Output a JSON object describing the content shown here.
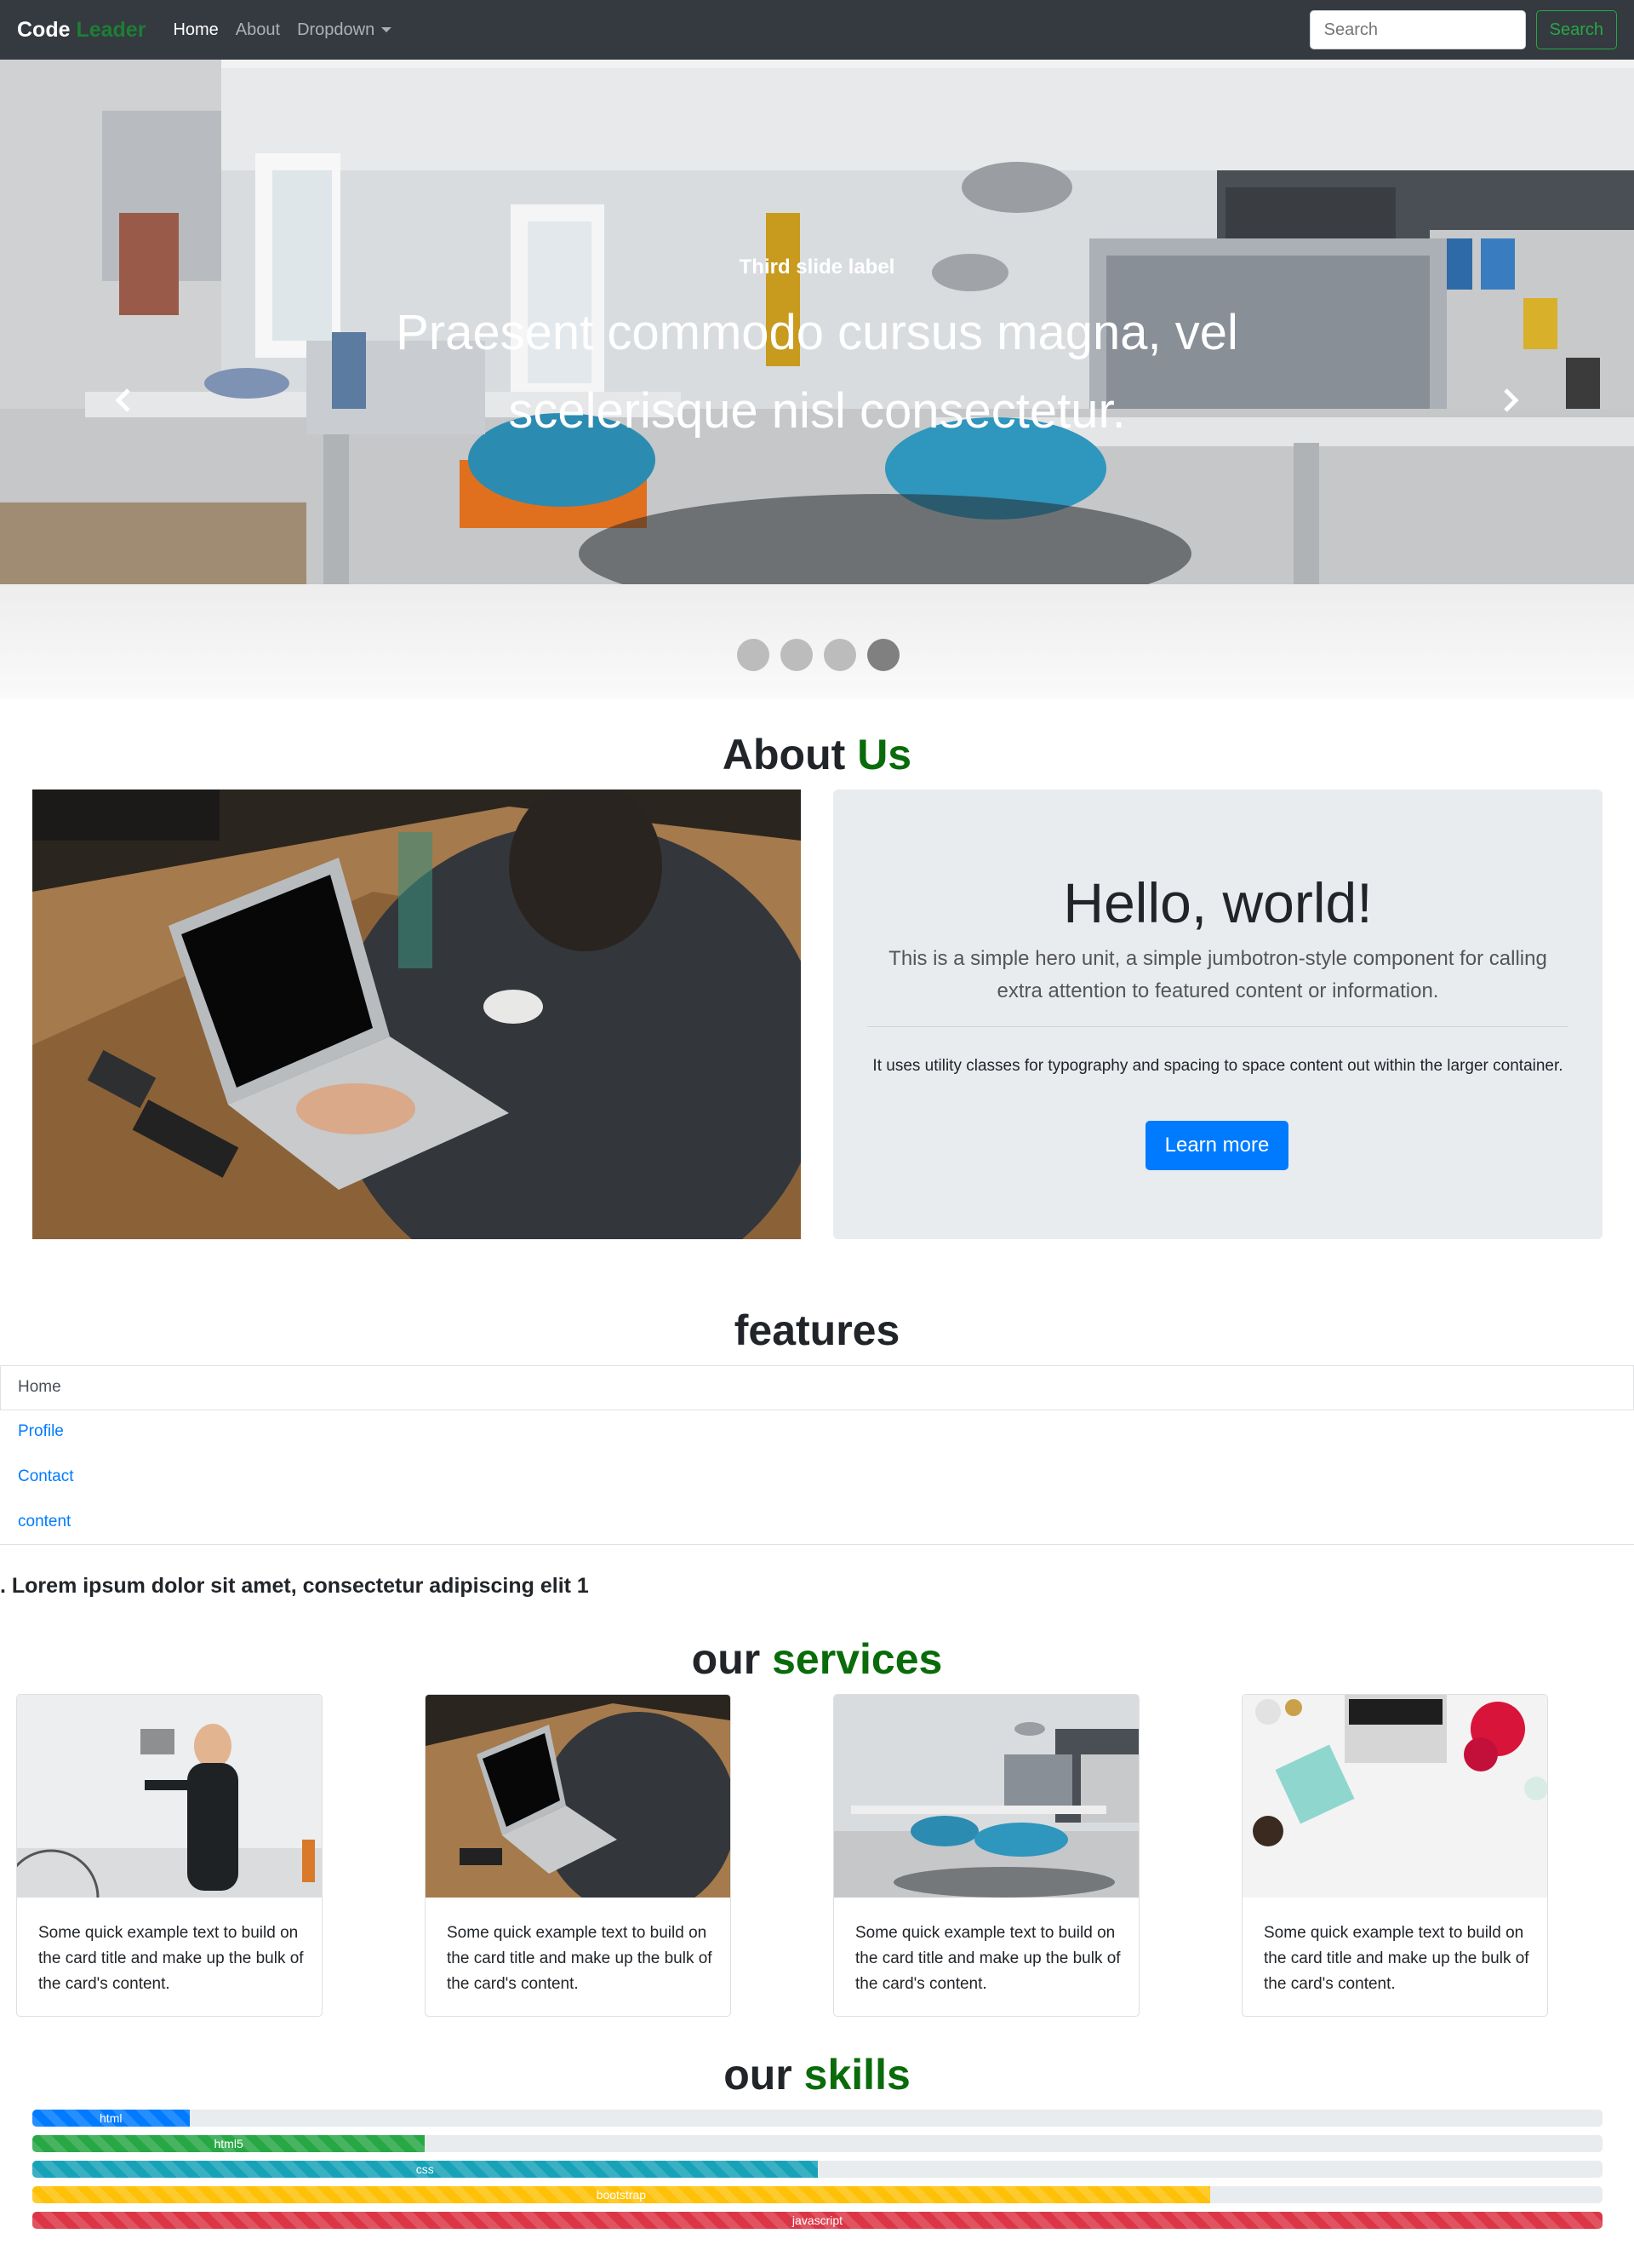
{
  "navbar": {
    "brand_main": "Code",
    "brand_accent": "Leader",
    "links": [
      "Home",
      "About",
      "Dropdown"
    ],
    "search_placeholder": "Search",
    "search_button": "Search"
  },
  "carousel": {
    "label": "Third slide label",
    "text": "Praesent commodo cursus magna, vel scelerisque nisl consectetur.",
    "slide_count": 4,
    "active_slide": 4
  },
  "about": {
    "title_main": "About",
    "title_accent": "Us",
    "jumbotron": {
      "heading": "Hello, world!",
      "lead": "This is a simple hero unit, a simple jumbotron-style component for calling extra attention to featured content or information.",
      "text": "It uses utility classes for typography and spacing to space content out within the larger container.",
      "button": "Learn more"
    }
  },
  "features": {
    "title": "features",
    "items": [
      "Home",
      "Profile",
      "Contact",
      "content"
    ],
    "active_item": "Home",
    "body": ". Lorem ipsum dolor sit amet, consectetur adipiscing elit 1"
  },
  "services": {
    "title_main": "our",
    "title_accent": "services",
    "cards": [
      {
        "text": "Some quick example text to build on the card title and make up the bulk of the card's content."
      },
      {
        "text": "Some quick example text to build on the card title and make up the bulk of the card's content."
      },
      {
        "text": "Some quick example text to build on the card title and make up the bulk of the card's content."
      },
      {
        "text": "Some quick example text to build on the card title and make up the bulk of the card's content."
      }
    ]
  },
  "skills": {
    "title_main": "our",
    "title_accent": "skills",
    "bars": [
      {
        "label": "html",
        "percent": 10,
        "color": "#007bff"
      },
      {
        "label": "html5",
        "percent": 25,
        "color": "#28a745"
      },
      {
        "label": "css",
        "percent": 50,
        "color": "#17a2b8"
      },
      {
        "label": "bootstrap",
        "percent": 75,
        "color": "#ffc107"
      },
      {
        "label": "javascript",
        "percent": 100,
        "color": "#dc3545"
      }
    ]
  },
  "colors": {
    "navbar_bg": "#343a40",
    "brand_accent": "#1e7e34",
    "title_accent": "#0a6b0a",
    "primary": "#007bff",
    "success": "#28a745",
    "jumbotron_bg": "#e9ecef"
  }
}
